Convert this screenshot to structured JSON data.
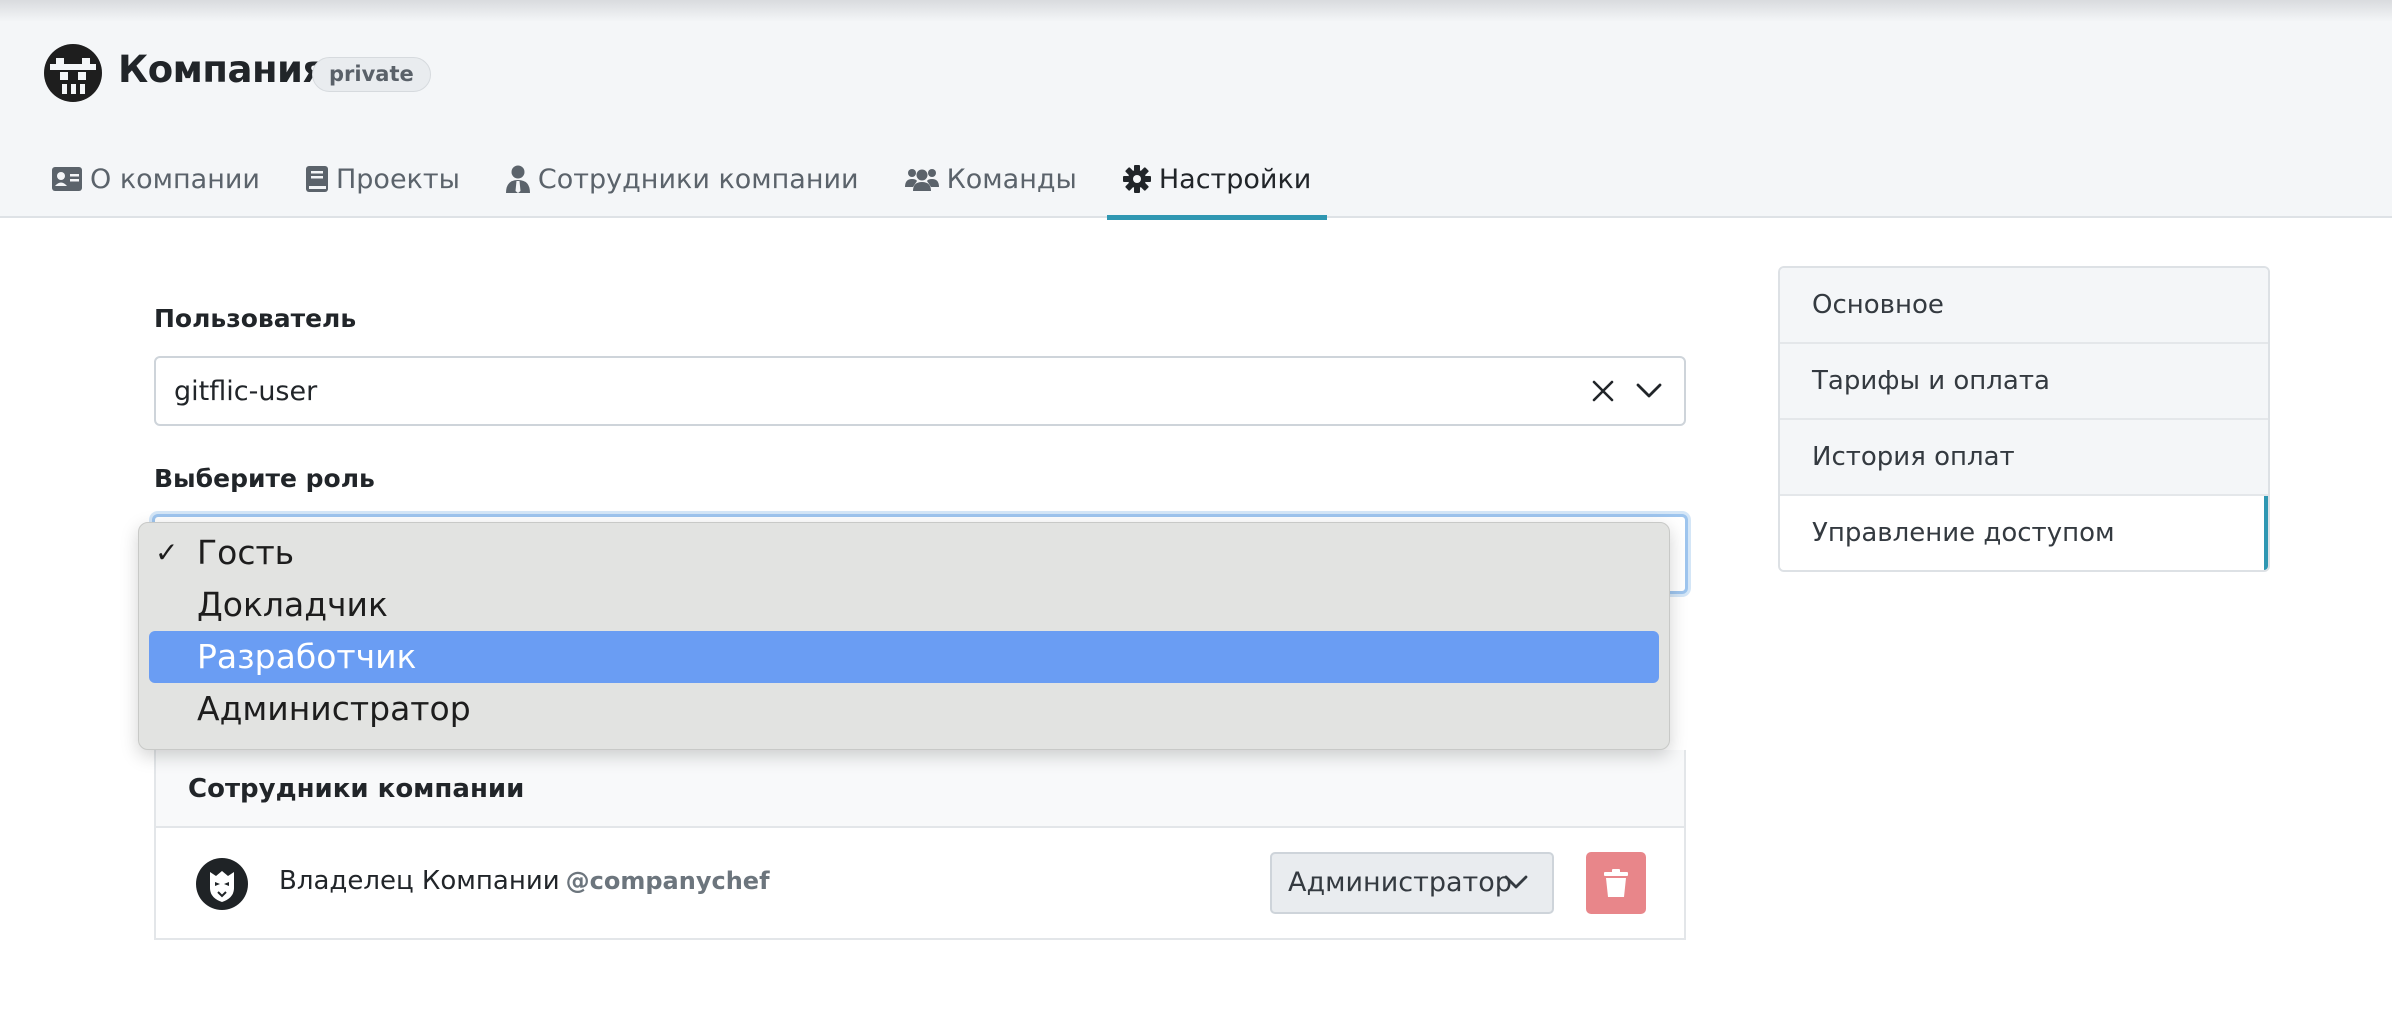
{
  "header": {
    "company_name": "Компания",
    "visibility_badge": "private",
    "tabs": [
      {
        "label": "О компании",
        "icon": "id-card-icon"
      },
      {
        "label": "Проекты",
        "icon": "book-icon"
      },
      {
        "label": "Сотрудники компании",
        "icon": "user-tie-icon"
      },
      {
        "label": "Команды",
        "icon": "users-icon"
      },
      {
        "label": "Настройки",
        "icon": "gear-icon",
        "active": true
      }
    ]
  },
  "form": {
    "user_label": "Пользователь",
    "user_value": "gitflic-user",
    "role_label": "Выберите роль",
    "role_options": [
      {
        "label": "Гость",
        "checked": true
      },
      {
        "label": "Докладчик"
      },
      {
        "label": "Разработчик",
        "highlighted": true
      },
      {
        "label": "Администратор"
      }
    ]
  },
  "members": {
    "title": "Сотрудники компании",
    "rows": [
      {
        "name": "Владелец Компании",
        "handle": "@companychef",
        "role": "Администратор"
      }
    ]
  },
  "side_nav": {
    "items": [
      {
        "label": "Основное"
      },
      {
        "label": "Тарифы и оплата"
      },
      {
        "label": "История оплат"
      },
      {
        "label": "Управление доступом",
        "active": true
      }
    ]
  },
  "colors": {
    "accent": "#2f97b2",
    "highlight": "#6a9df3",
    "danger": "#e8868a"
  }
}
